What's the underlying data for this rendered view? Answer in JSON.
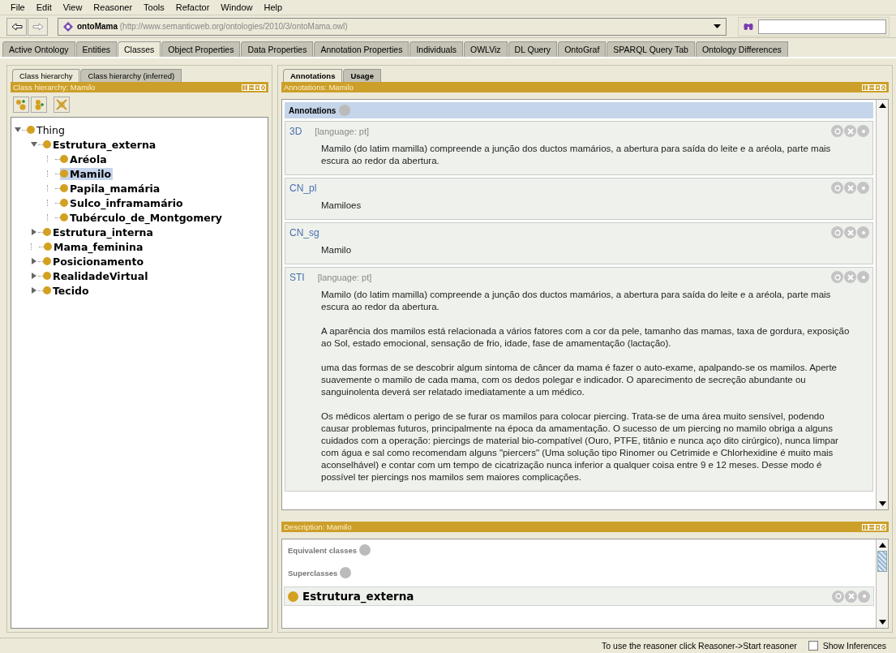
{
  "menu": [
    "File",
    "Edit",
    "View",
    "Reasoner",
    "Tools",
    "Refactor",
    "Window",
    "Help"
  ],
  "address": {
    "name": "ontoMama",
    "iri": "(http://www.semanticweb.org/ontologies/2010/3/ontoMama.owl)"
  },
  "tabs": [
    {
      "label": "Active Ontology",
      "selected": false
    },
    {
      "label": "Entities",
      "selected": false
    },
    {
      "label": "Classes",
      "selected": true
    },
    {
      "label": "Object Properties",
      "selected": false
    },
    {
      "label": "Data Properties",
      "selected": false
    },
    {
      "label": "Annotation Properties",
      "selected": false
    },
    {
      "label": "Individuals",
      "selected": false
    },
    {
      "label": "OWLViz",
      "selected": false
    },
    {
      "label": "DL Query",
      "selected": false
    },
    {
      "label": "OntoGraf",
      "selected": false
    },
    {
      "label": "SPARQL Query Tab",
      "selected": false
    },
    {
      "label": "Ontology Differences",
      "selected": false
    }
  ],
  "left_tabs": [
    {
      "label": "Class hierarchy",
      "selected": true
    },
    {
      "label": "Class hierarchy (inferred)",
      "selected": false
    }
  ],
  "left_header": "Class hierarchy: Mamilo",
  "tree": [
    {
      "label": "Thing",
      "kind": "branch",
      "expanded": true,
      "selected": false,
      "children": [
        {
          "label": "Estrutura_externa",
          "kind": "branch",
          "expanded": true,
          "selected": false,
          "children": [
            {
              "label": "Aréola",
              "kind": "leaf",
              "selected": false
            },
            {
              "label": "Mamilo",
              "kind": "leaf",
              "selected": true
            },
            {
              "label": "Papila_mamária",
              "kind": "leaf",
              "selected": false
            },
            {
              "label": "Sulco_inframamário",
              "kind": "leaf",
              "selected": false
            },
            {
              "label": "Tubérculo_de_Montgomery",
              "kind": "leaf",
              "selected": false
            }
          ]
        },
        {
          "label": "Estrutura_interna",
          "kind": "branch",
          "expanded": false,
          "selected": false
        },
        {
          "label": "Mama_feminina",
          "kind": "leaf",
          "selected": false
        },
        {
          "label": "Posicionamento",
          "kind": "branch",
          "expanded": false,
          "selected": false
        },
        {
          "label": "RealidadeVirtual",
          "kind": "branch",
          "expanded": false,
          "selected": false
        },
        {
          "label": "Tecido",
          "kind": "branch",
          "expanded": false,
          "selected": false
        }
      ]
    }
  ],
  "right_tabs": [
    {
      "label": "Annotations",
      "selected": true
    },
    {
      "label": "Usage",
      "selected": false
    }
  ],
  "annotations_header": "Annotations: Mamilo",
  "annotations_title": "Annotations",
  "annotations": [
    {
      "property": "3D",
      "language": "[language: pt]",
      "paragraphs": [
        "Mamilo (do latim mamilla) compreende a junção dos ductos mamários, a abertura para saída do leite e a aréola, parte mais escura ao redor da abertura."
      ]
    },
    {
      "property": "CN_pl",
      "paragraphs": [
        "Mamiloes"
      ]
    },
    {
      "property": "CN_sg",
      "paragraphs": [
        "Mamilo"
      ]
    },
    {
      "property": "STI",
      "language": "[language: pt]",
      "paragraphs": [
        "Mamilo (do latim mamilla) compreende a junção dos ductos mamários, a abertura para saída do leite e a aréola, parte mais escura ao redor da abertura.",
        "A aparência dos mamilos está relacionada a vários fatores com a cor da pele, tamanho das mamas, taxa de gordura, exposição ao Sol, estado emocional, sensação de frio, idade, fase de amamentação (lactação).",
        "uma das formas de se descobrir algum sintoma de câncer da mama é fazer o auto-exame, apalpando-se os mamilos. Aperte suavemente o mamilo de cada mama, com os dedos polegar e indicador. O aparecimento de secreção abundante ou sanguinolenta deverá ser relatado imediatamente a um médico.",
        "Os médicos alertam o perigo de se furar os mamilos para colocar piercing. Trata-se de uma área muito sensível, podendo causar problemas futuros, principalmente na época da amamentação. O sucesso de um piercing no mamilo obriga a alguns cuidados com a operação: piercings de material bio-compatível (Ouro, PTFE, titânio e nunca aço dito cirúrgico), nunca limpar com água e sal como recomendam alguns \"piercers\" (Uma solução tipo Rinomer ou Cetrimide e Chlorhexidine é muito mais aconselhável) e contar com um tempo de cicatrização nunca inferior a qualquer coisa entre 9 e 12 meses. Desse modo é possível ter piercings nos mamilos sem maiores complicações."
      ]
    }
  ],
  "description_header": "Description: Mamilo",
  "description_sections": [
    {
      "title": "Equivalent classes"
    },
    {
      "title": "Superclasses",
      "items": [
        "Estrutura_externa"
      ]
    }
  ],
  "status": {
    "message": "To use the reasoner click Reasoner->Start reasoner",
    "show_inferences": {
      "label": "Show Inferences",
      "checked": false
    }
  }
}
